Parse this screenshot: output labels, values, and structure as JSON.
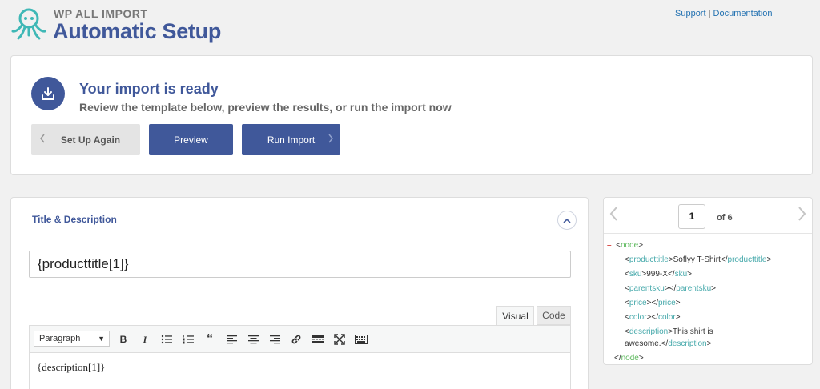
{
  "header": {
    "brand_small": "WP ALL IMPORT",
    "brand_title": "Automatic Setup",
    "support_link": "Support",
    "separator": "|",
    "documentation_link": "Documentation"
  },
  "ready": {
    "title": "Your import is ready",
    "subtitle": "Review the template below, preview the results, or run the import now",
    "buttons": {
      "setup_again": "Set Up Again",
      "preview": "Preview",
      "run_import": "Run Import"
    }
  },
  "title_description": {
    "heading": "Title & Description",
    "title_value": "{producttitle[1]}",
    "tabs": {
      "visual": "Visual",
      "code": "Code"
    },
    "format_select": "Paragraph",
    "editor_content": "{description[1]}"
  },
  "xml_viewer": {
    "page_current": "1",
    "page_of": "of 6",
    "collapse_marker": "–",
    "lines": [
      {
        "open": "<",
        "tag": "node",
        "close": ">"
      },
      {
        "tag": "producttitle",
        "value": "Soflyy T-Shirt"
      },
      {
        "tag": "sku",
        "value": "999-X"
      },
      {
        "tag": "parentsku",
        "value": ""
      },
      {
        "tag": "price",
        "value": ""
      },
      {
        "tag": "color",
        "value": ""
      },
      {
        "tag": "description",
        "value_line1": "This shirt is",
        "value_line2": "awesome."
      },
      {
        "tag": "node"
      }
    ]
  },
  "colors": {
    "brand": "#40589a",
    "link": "#2271b1",
    "xml_tag": "#46a9ab",
    "xml_node": "#5cb85c",
    "xml_minus": "#d9534f"
  }
}
